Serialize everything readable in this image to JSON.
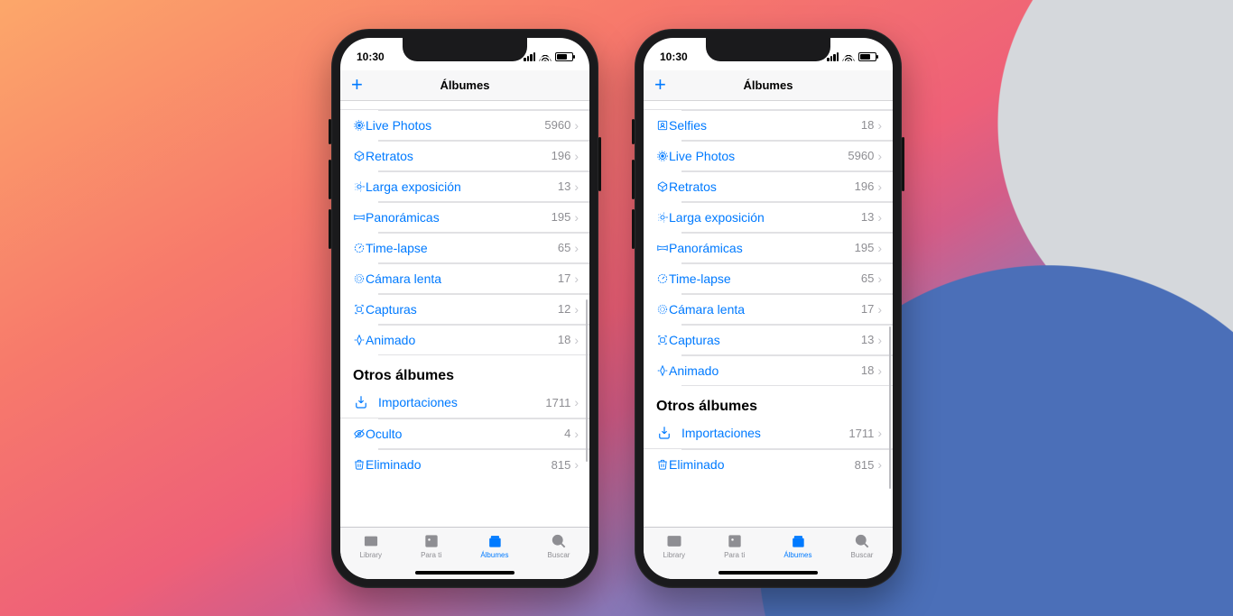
{
  "status": {
    "time": "10:30"
  },
  "navbar": {
    "title": "Álbumes",
    "plus": "+"
  },
  "section_other": "Otros álbumes",
  "tabs": {
    "library": "Library",
    "forYou": "Para ti",
    "albums": "Álbumes",
    "search": "Buscar"
  },
  "phone1": {
    "rows": [
      {
        "icon": "live",
        "label": "Live Photos",
        "count": "5960"
      },
      {
        "icon": "portrait",
        "label": "Retratos",
        "count": "196"
      },
      {
        "icon": "longexp",
        "label": "Larga exposición",
        "count": "13"
      },
      {
        "icon": "pano",
        "label": "Panorámicas",
        "count": "195"
      },
      {
        "icon": "timelapse",
        "label": "Time-lapse",
        "count": "65"
      },
      {
        "icon": "slomo",
        "label": "Cámara lenta",
        "count": "17"
      },
      {
        "icon": "screen",
        "label": "Capturas",
        "count": "12"
      },
      {
        "icon": "animated",
        "label": "Animado",
        "count": "18"
      }
    ],
    "other": [
      {
        "icon": "import",
        "label": "Importaciones",
        "count": "1711"
      },
      {
        "icon": "hidden",
        "label": "Oculto",
        "count": "4"
      },
      {
        "icon": "trash",
        "label": "Eliminado",
        "count": "815"
      }
    ]
  },
  "phone2": {
    "rows": [
      {
        "icon": "selfie",
        "label": "Selfies",
        "count": "18"
      },
      {
        "icon": "live",
        "label": "Live Photos",
        "count": "5960"
      },
      {
        "icon": "portrait",
        "label": "Retratos",
        "count": "196"
      },
      {
        "icon": "longexp",
        "label": "Larga exposición",
        "count": "13"
      },
      {
        "icon": "pano",
        "label": "Panorámicas",
        "count": "195"
      },
      {
        "icon": "timelapse",
        "label": "Time-lapse",
        "count": "65"
      },
      {
        "icon": "slomo",
        "label": "Cámara lenta",
        "count": "17"
      },
      {
        "icon": "screen",
        "label": "Capturas",
        "count": "13"
      },
      {
        "icon": "animated",
        "label": "Animado",
        "count": "18"
      }
    ],
    "other": [
      {
        "icon": "import",
        "label": "Importaciones",
        "count": "1711"
      },
      {
        "icon": "trash",
        "label": "Eliminado",
        "count": "815"
      }
    ]
  }
}
